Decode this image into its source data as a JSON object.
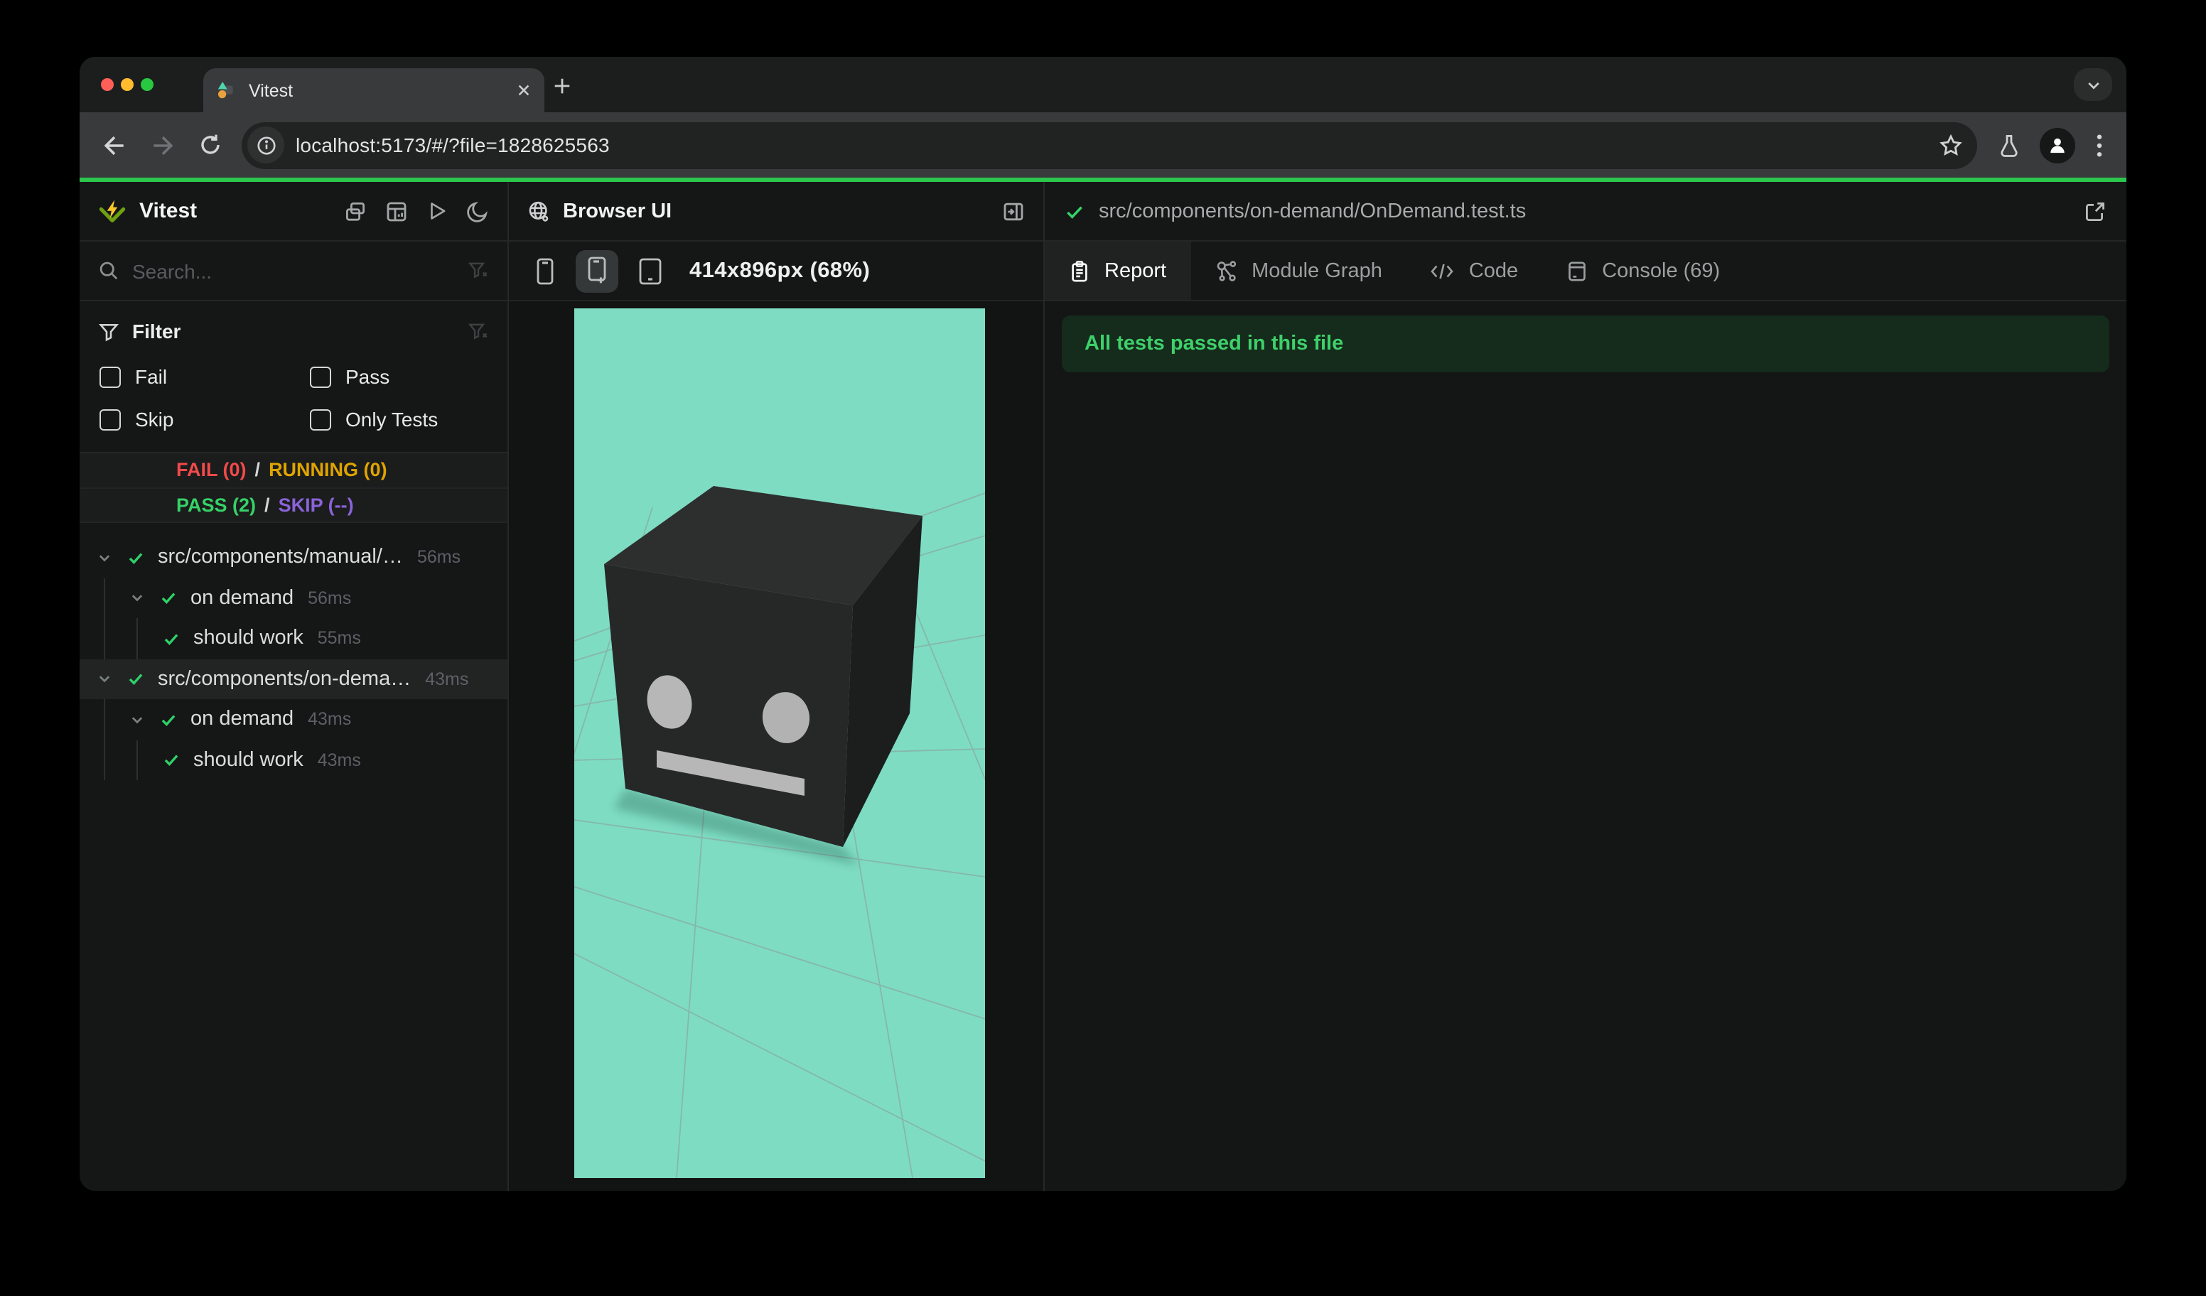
{
  "browser": {
    "tab": {
      "title": "Vitest"
    },
    "url": "localhost:5173/#/?file=1828625563",
    "icons": [
      "vitest-favicon",
      "tab-close",
      "new-tab-plus",
      "tab-list-chevron",
      "back-arrow",
      "forward-arrow",
      "reload",
      "site-info",
      "bookmark-star",
      "experiments-flask",
      "profile-avatar",
      "menu-dots"
    ]
  },
  "sidebar": {
    "title": "Vitest",
    "header_icons": [
      "windows-overlap",
      "dashboard",
      "run-all-play",
      "theme-moon"
    ],
    "search": {
      "placeholder": "Search...",
      "icon": "search",
      "clear_icon": "filter-clear"
    },
    "filter": {
      "label": "Filter",
      "icon": "funnel",
      "clear_icon": "filter-clear",
      "checkboxes": [
        {
          "label": "Fail",
          "checked": false
        },
        {
          "label": "Pass",
          "checked": false
        },
        {
          "label": "Skip",
          "checked": false
        },
        {
          "label": "Only Tests",
          "checked": false
        }
      ]
    },
    "stats": {
      "fail": "FAIL (0)",
      "running": "RUNNING (0)",
      "pass": "PASS (2)",
      "skip": "SKIP (--)",
      "separator": "/"
    },
    "tree": [
      {
        "type": "file",
        "name": "src/components/manual/…",
        "duration": "56ms",
        "status": "pass",
        "expanded": true,
        "selected": false
      },
      {
        "type": "suite",
        "name": "on demand",
        "duration": "56ms",
        "status": "pass",
        "expanded": true,
        "selected": false
      },
      {
        "type": "test",
        "name": "should work",
        "duration": "55ms",
        "status": "pass",
        "expanded": false,
        "selected": false
      },
      {
        "type": "file",
        "name": "src/components/on-dema…",
        "duration": "43ms",
        "status": "pass",
        "expanded": true,
        "selected": true
      },
      {
        "type": "suite",
        "name": "on demand",
        "duration": "43ms",
        "status": "pass",
        "expanded": true,
        "selected": false
      },
      {
        "type": "test",
        "name": "should work",
        "duration": "43ms",
        "status": "pass",
        "expanded": false,
        "selected": false
      }
    ]
  },
  "browser_ui_panel": {
    "title": "Browser UI",
    "title_icon": "globe",
    "dock_icon": "panel-right",
    "device_buttons": [
      "phone-small",
      "phone-plus-active",
      "tablet"
    ],
    "resolution": "414x896px (68%)",
    "viewport_colors": {
      "background": "#7edcc3",
      "grid_line": "#8aa29b",
      "cube_top": "#2d2e2e",
      "cube_front": "#262727",
      "cube_side": "#1c1d1d",
      "face_features": "#b7b7b7"
    }
  },
  "report_panel": {
    "file_status_icon": "check",
    "file_path": "src/components/on-demand/OnDemand.test.ts",
    "open_icon": "external-link",
    "tabs": [
      {
        "label": "Report",
        "icon": "clipboard",
        "active": true
      },
      {
        "label": "Module Graph",
        "icon": "graph",
        "active": false
      },
      {
        "label": "Code",
        "icon": "code",
        "active": false
      },
      {
        "label": "Console (69)",
        "icon": "terminal",
        "active": false
      }
    ],
    "banner": {
      "text": "All tests passed in this file",
      "text_color": "#3ed06b",
      "background": "#152b1b"
    }
  },
  "colors": {
    "accent_green_line": "#2bc84d",
    "fail_red": "#f24a4a",
    "running_yellow": "#dfa400",
    "pass_green": "#36d268",
    "skip_purple": "#8a63d9",
    "traffic_red": "#ff5f57",
    "traffic_yellow": "#febc2e",
    "traffic_green": "#28c840"
  }
}
